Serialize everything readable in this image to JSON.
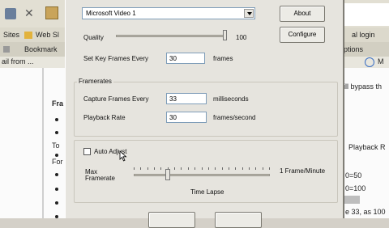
{
  "browser": {
    "toolbar": {
      "close_glyph": "✕",
      "sites_label": "Sites",
      "web_slice_label": "Web Sl",
      "bookmark_label": "Bookmark",
      "email_tab_label": "ail from ...",
      "login_label": "al login",
      "options_label": "ptions"
    },
    "content": {
      "heading_fragment": "Fra",
      "left_fragments": [
        "To",
        "For"
      ],
      "right_fragments": [
        "ill bypass th",
        "Playback R",
        "0=50",
        "0=100",
        "e 33, as 100"
      ]
    }
  },
  "dialog": {
    "compressor": {
      "selected": "Microsoft Video 1",
      "about_label": "About",
      "configure_label": "Configure",
      "quality_label": "Quality",
      "quality_value": "100",
      "quality_level": 1.0,
      "key_frames_label": "Set Key Frames Every",
      "key_frames_value": "30",
      "key_frames_unit": "frames"
    },
    "framerates": {
      "legend": "Framerates",
      "capture_label": "Capture Frames Every",
      "capture_value": "33",
      "capture_unit": "milliseconds",
      "playback_label": "Playback Rate",
      "playback_value": "30",
      "playback_unit": "frames/second"
    },
    "auto_adjust": {
      "label": "Auto Adjust",
      "checked": false,
      "max_label_1": "Max",
      "max_label_2": "Framerate",
      "max_value_label": "1 Frame/Minute",
      "time_lapse_label": "Time Lapse",
      "slider_level": 0.25
    }
  }
}
